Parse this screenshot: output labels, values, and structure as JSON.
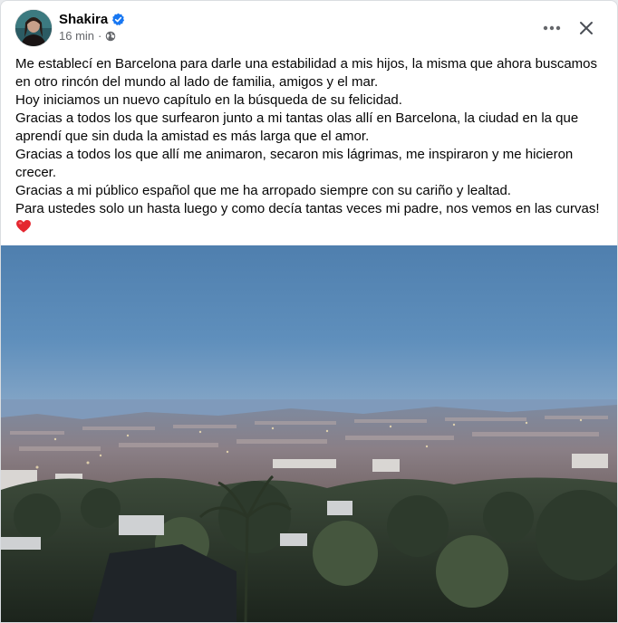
{
  "post": {
    "author": "Shakira",
    "time": "16 min",
    "dot": "·",
    "paragraphs": [
      "Me establecí en Barcelona para darle una estabilidad a mis hijos, la misma que ahora buscamos en otro rincón del mundo al lado de familia, amigos y el mar.",
      "Hoy iniciamos un nuevo capítulo en la búsqueda de su felicidad.",
      "Gracias a todos los que surfearon junto a mi tantas olas allí en Barcelona, la ciudad en la que aprendí que sin duda la amistad  es más larga que el amor.",
      "Gracias a todos los que allí me animaron, secaron mis lágrimas, me inspiraron y me hicieron crecer.",
      "Gracias a mi público español que me ha arropado siempre con su cariño y lealtad.",
      "Para ustedes solo un hasta luego y como decía tantas veces mi padre, nos vemos en las curvas!"
    ],
    "emoji": "heart-icon",
    "photo": "barcelona-city-view-at-dusk"
  },
  "icons": {
    "verified": "verified-badge-icon",
    "audience": "globe-icon",
    "more": "more-options-icon",
    "close": "close-icon"
  },
  "colors": {
    "verified": "#1877f2",
    "heart": "#e4262f",
    "text": "#050505",
    "secondary": "#65676b"
  }
}
